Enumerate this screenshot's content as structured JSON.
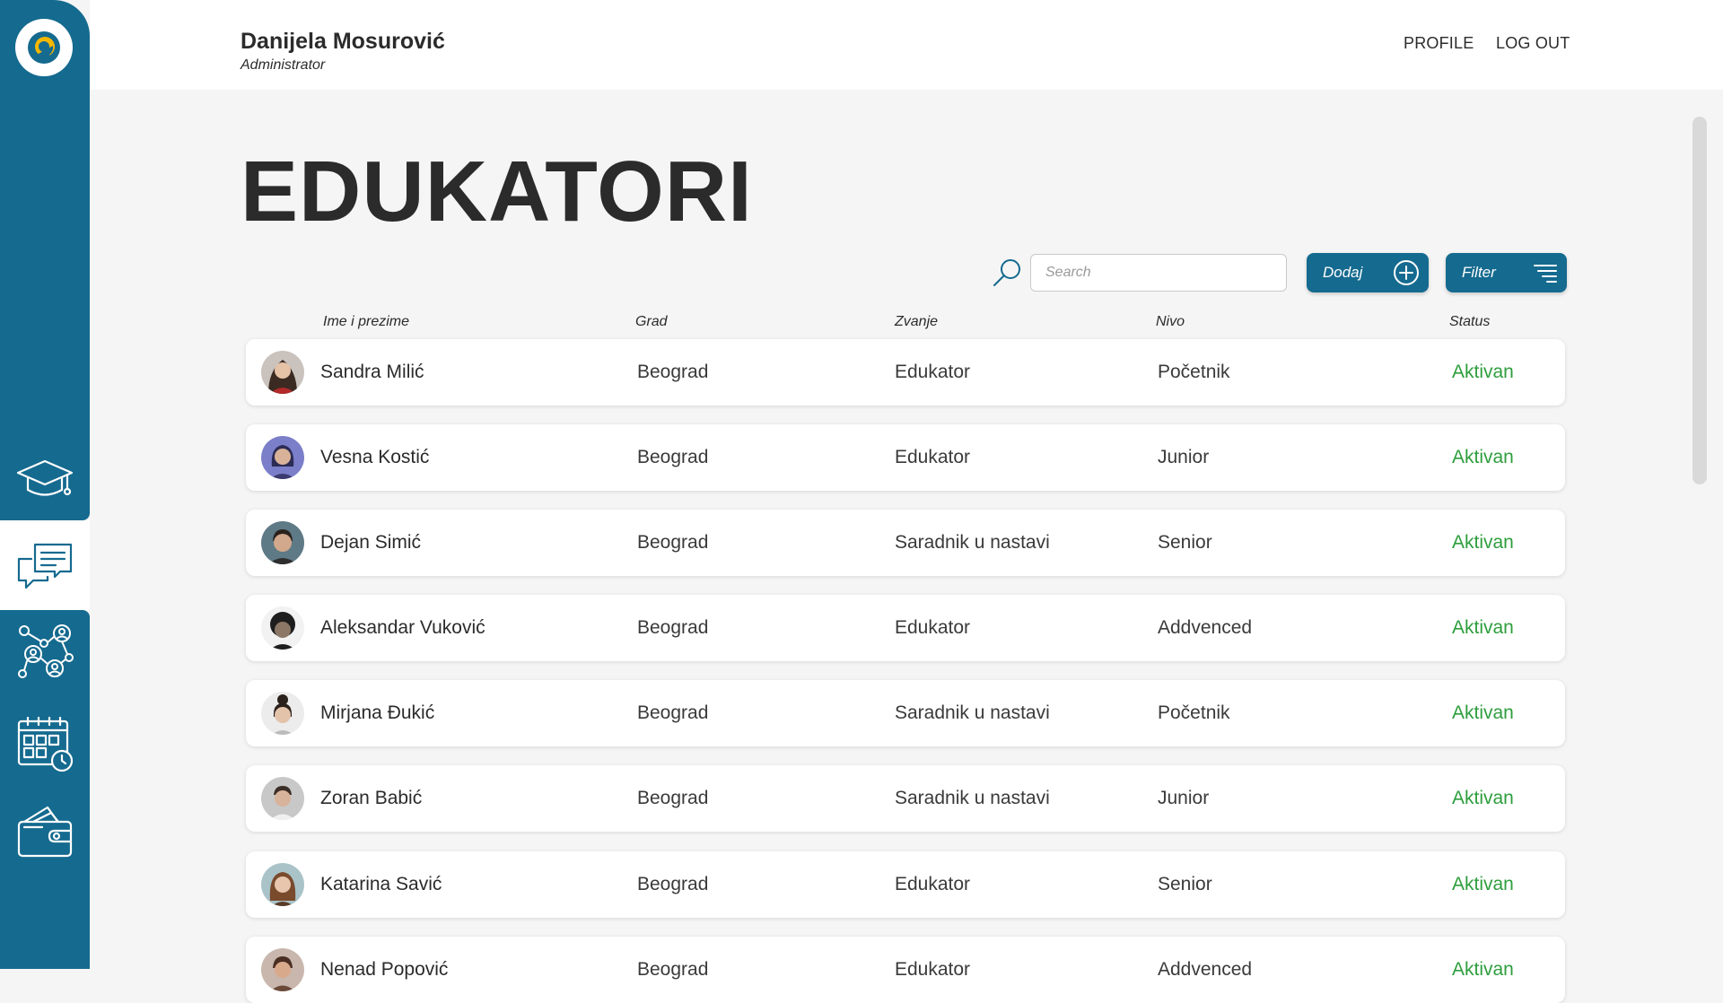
{
  "user": {
    "name": "Danijela Mosurović",
    "role": "Administrator"
  },
  "nav": {
    "profile": "PROFILE",
    "logout": "LOG OUT"
  },
  "sidebar": {
    "icons": [
      "education-icon",
      "chat-icon",
      "network-icon",
      "calendar-icon",
      "wallet-icon"
    ],
    "active": "chat-icon"
  },
  "page": {
    "title": "EDUKATORI"
  },
  "toolbar": {
    "search_placeholder": "Search",
    "add_label": "Dodaj",
    "filter_label": "Filter"
  },
  "table": {
    "headers": {
      "name": "Ime i prezime",
      "city": "Grad",
      "title": "Zvanje",
      "level": "Nivo",
      "status": "Status"
    },
    "rows": [
      {
        "name": "Sandra Milić",
        "city": "Beograd",
        "title": "Edukator",
        "level": "Početnik",
        "status": "Aktivan"
      },
      {
        "name": "Vesna Kostić",
        "city": "Beograd",
        "title": "Edukator",
        "level": "Junior",
        "status": "Aktivan"
      },
      {
        "name": "Dejan Simić",
        "city": "Beograd",
        "title": "Saradnik u nastavi",
        "level": "Senior",
        "status": "Aktivan"
      },
      {
        "name": "Aleksandar Vuković",
        "city": "Beograd",
        "title": "Edukator",
        "level": "Addvenced",
        "status": "Aktivan"
      },
      {
        "name": "Mirjana Đukić",
        "city": "Beograd",
        "title": "Saradnik u nastavi",
        "level": "Početnik",
        "status": "Aktivan"
      },
      {
        "name": "Zoran Babić",
        "city": "Beograd",
        "title": "Saradnik u nastavi",
        "level": "Junior",
        "status": "Aktivan"
      },
      {
        "name": "Katarina Savić",
        "city": "Beograd",
        "title": "Edukator",
        "level": "Senior",
        "status": "Aktivan"
      },
      {
        "name": "Nenad Popović",
        "city": "Beograd",
        "title": "Edukator",
        "level": "Addvenced",
        "status": "Aktivan"
      }
    ]
  },
  "colors": {
    "primary": "#156a8f",
    "accent": "#f5b800",
    "status_active": "#2e9e3d",
    "background": "#f5f5f5"
  }
}
